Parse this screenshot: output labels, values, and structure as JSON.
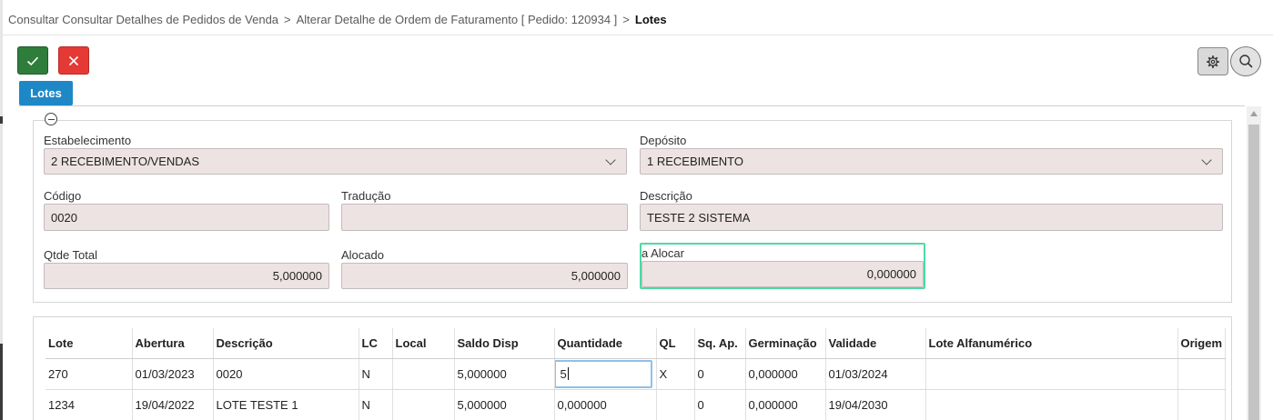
{
  "breadcrumb": {
    "items": [
      "Consultar Consultar Detalhes de Pedidos de Venda",
      "Alterar Detalhe de Ordem de Faturamento [ Pedido: 120934 ]"
    ],
    "separator": ">",
    "current": "Lotes"
  },
  "toolbar": {
    "confirm_icon": "check-icon",
    "cancel_icon": "close-icon",
    "settings_icon": "gear-icon",
    "search_icon": "search-icon"
  },
  "tabs": [
    {
      "label": "Lotes",
      "active": true
    }
  ],
  "form": {
    "estabelecimento": {
      "label": "Estabelecimento",
      "value": "2 RECEBIMENTO/VENDAS"
    },
    "deposito": {
      "label": "Depósito",
      "value": "1 RECEBIMENTO"
    },
    "codigo": {
      "label": "Código",
      "value": "0020"
    },
    "traducao": {
      "label": "Tradução",
      "value": ""
    },
    "descricao": {
      "label": "Descrição",
      "value": "TESTE 2 SISTEMA"
    },
    "qtde_total": {
      "label": "Qtde Total",
      "value": "5,000000"
    },
    "alocado": {
      "label": "Alocado",
      "value": "5,000000"
    },
    "a_alocar": {
      "label": "a Alocar",
      "value": "0,000000"
    }
  },
  "grid": {
    "columns": [
      "Lote",
      "Abertura",
      "Descrição",
      "LC",
      "Local",
      "Saldo Disp",
      "Quantidade",
      "QL",
      "Sq. Ap.",
      "Germinação",
      "Validade",
      "Lote Alfanumérico",
      "Origem"
    ],
    "rows": [
      [
        "270",
        "01/03/2023",
        "0020",
        "N",
        "",
        "5,000000",
        "5",
        "X",
        "0",
        "0,000000",
        "01/03/2024",
        "",
        ""
      ],
      [
        "1234",
        "19/04/2022",
        "LOTE TESTE 1",
        "N",
        "",
        "5,000000",
        "0,000000",
        "",
        "0",
        "0,000000",
        "19/04/2030",
        "",
        ""
      ]
    ]
  },
  "colors": {
    "confirm": "#2e7d3b",
    "cancel": "#e53936",
    "tab_active": "#1e88c7",
    "focus_highlight": "#4fd9a3",
    "input_bg": "#ede3e3"
  }
}
